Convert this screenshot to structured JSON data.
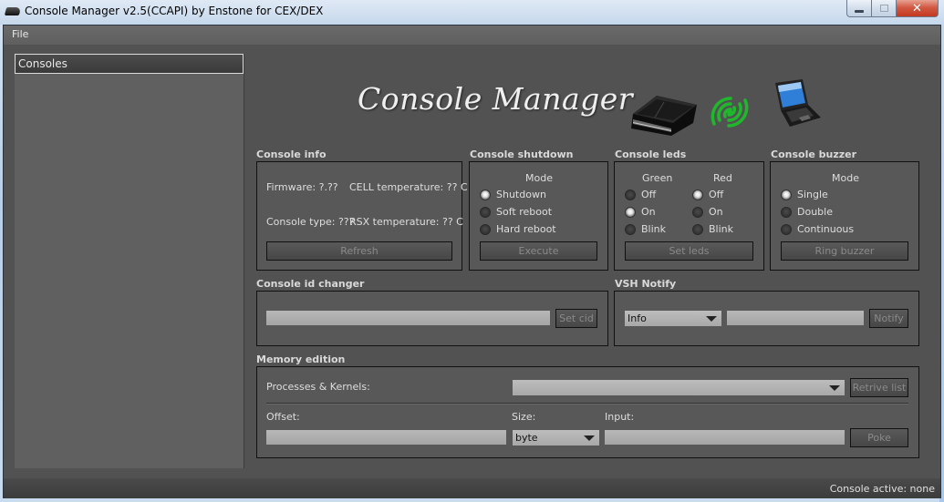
{
  "window": {
    "title": "Console Manager v2.5(CCAPI) by Enstone for CEX/DEX",
    "buttons": {
      "minimize": "minimize",
      "maximize": "maximize",
      "close": "✕"
    }
  },
  "menu": {
    "file": "File"
  },
  "sidebar": {
    "header": "Consoles"
  },
  "logo": {
    "text": "Console Manager",
    "icons": [
      "ps3-console-icon",
      "wireless-signal-icon",
      "laptop-icon"
    ],
    "signal_color": "#1fb82c"
  },
  "console_info": {
    "title": "Console info",
    "firmware": "Firmware: ?.??",
    "cell_temp": "CELL temperature: ?? C",
    "console_type": "Console type: ???",
    "rsx_temp": "RSX temperature: ?? C",
    "refresh_label": "Refresh"
  },
  "console_shutdown": {
    "title": "Console shutdown",
    "mode_label": "Mode",
    "options": [
      {
        "label": "Shutdown",
        "checked": true
      },
      {
        "label": "Soft reboot",
        "checked": false
      },
      {
        "label": "Hard reboot",
        "checked": false
      }
    ],
    "execute_label": "Execute"
  },
  "console_leds": {
    "title": "Console leds",
    "green_label": "Green",
    "red_label": "Red",
    "green_options": [
      {
        "label": "Off",
        "checked": false
      },
      {
        "label": "On",
        "checked": true
      },
      {
        "label": "Blink",
        "checked": false
      }
    ],
    "red_options": [
      {
        "label": "Off",
        "checked": true
      },
      {
        "label": "On",
        "checked": false
      },
      {
        "label": "Blink",
        "checked": false
      }
    ],
    "set_label": "Set leds"
  },
  "console_buzzer": {
    "title": "Console buzzer",
    "mode_label": "Mode",
    "options": [
      {
        "label": "Single",
        "checked": true
      },
      {
        "label": "Double",
        "checked": false
      },
      {
        "label": "Continuous",
        "checked": false
      }
    ],
    "ring_label": "Ring buzzer"
  },
  "cid_changer": {
    "title": "Console id changer",
    "input_value": "",
    "set_label": "Set cid"
  },
  "vsh_notify": {
    "title": "VSH Notify",
    "type_selected": "Info",
    "message_value": "",
    "notify_label": "Notify"
  },
  "memory_edition": {
    "title": "Memory edition",
    "processes_label": "Processes & Kernels:",
    "processes_selected": "",
    "retrieve_label": "Retrive list",
    "offset_label": "Offset:",
    "offset_value": "",
    "size_label": "Size:",
    "size_selected": "byte",
    "input_label": "Input:",
    "input_value": "",
    "poke_label": "Poke"
  },
  "status": {
    "text": "Console active: none"
  }
}
